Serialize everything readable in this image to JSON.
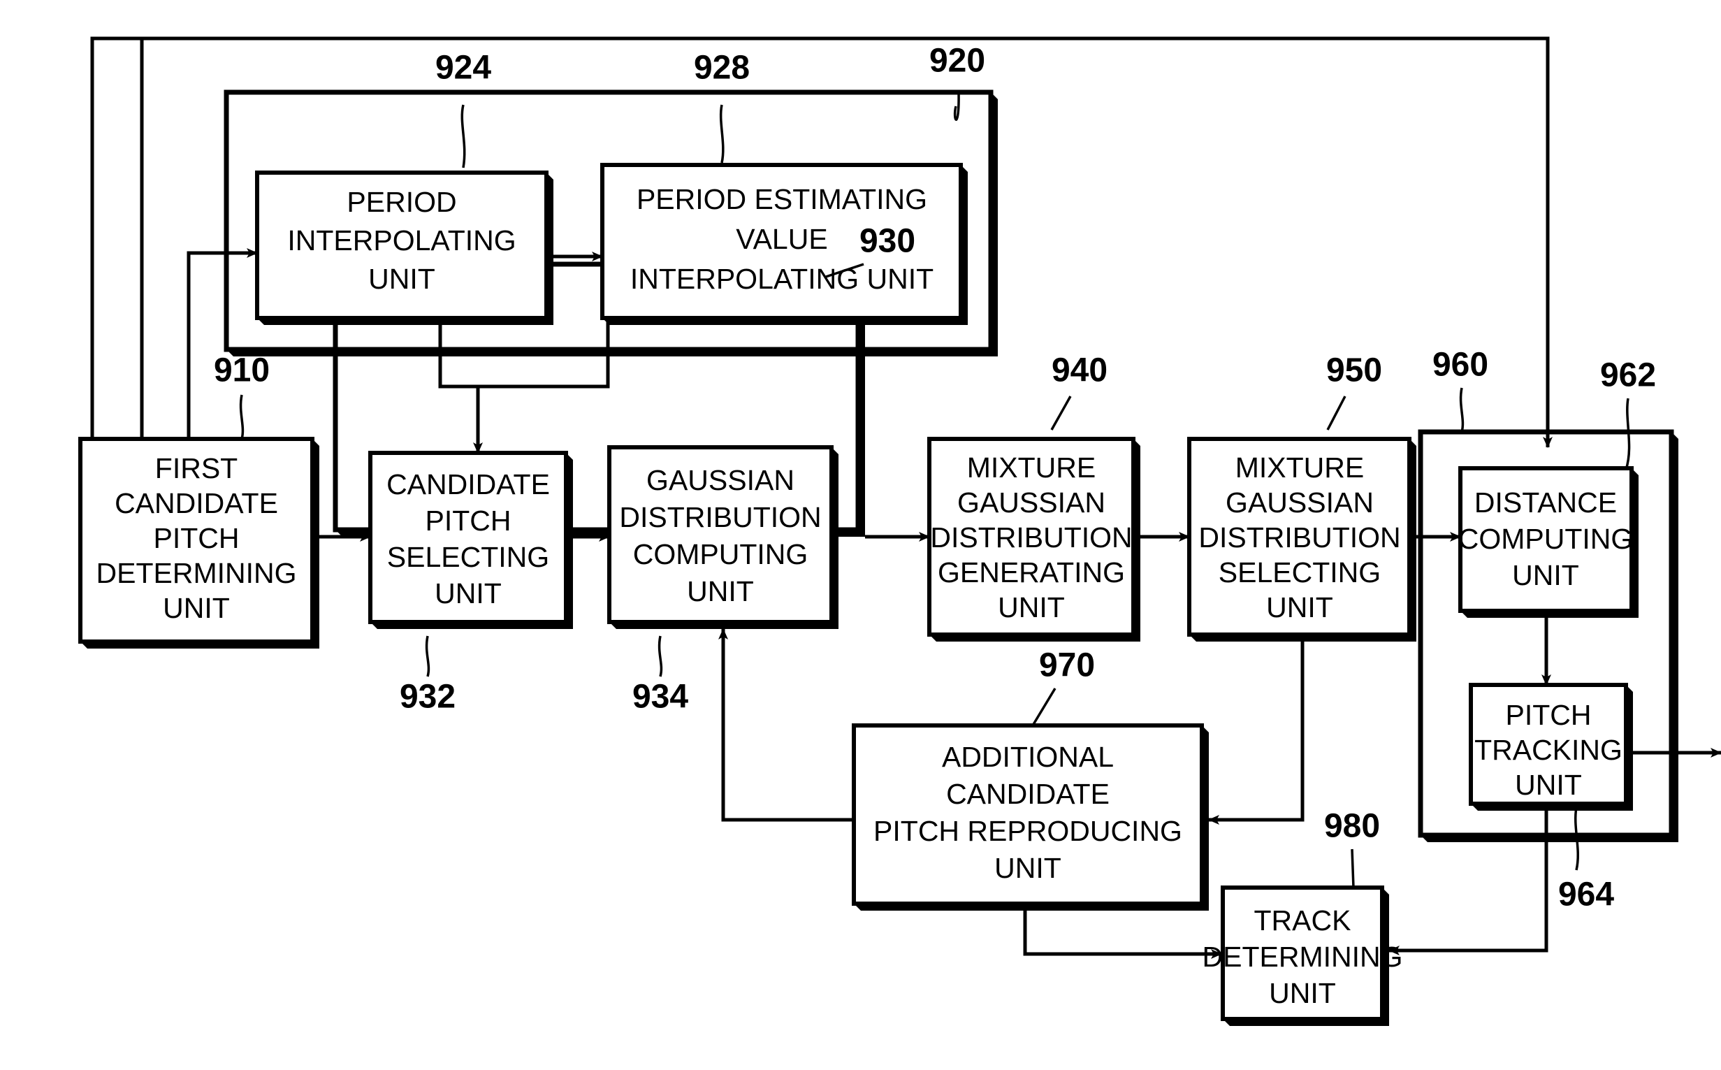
{
  "figure": {
    "type": "patent-block-diagram",
    "blocks": [
      {
        "id": "block-910",
        "ref": "910",
        "lines": [
          "FIRST",
          "CANDIDATE",
          "PITCH",
          "DETERMINING",
          "UNIT"
        ]
      },
      {
        "id": "block-924",
        "ref": "924",
        "lines": [
          "PERIOD",
          "INTERPOLATING",
          "UNIT"
        ]
      },
      {
        "id": "block-928",
        "ref": "928",
        "lines": [
          "PERIOD ESTIMATING",
          "VALUE",
          "INTERPOLATING UNIT"
        ]
      },
      {
        "id": "block-932",
        "ref": "932",
        "lines": [
          "CANDIDATE",
          "PITCH",
          "SELECTING",
          "UNIT"
        ]
      },
      {
        "id": "block-934",
        "ref": "934",
        "lines": [
          "GAUSSIAN",
          "DISTRIBUTION",
          "COMPUTING",
          "UNIT"
        ]
      },
      {
        "id": "block-940",
        "ref": "940",
        "lines": [
          "MIXTURE",
          "GAUSSIAN",
          "DISTRIBUTION",
          "GENERATING",
          "UNIT"
        ]
      },
      {
        "id": "block-950",
        "ref": "950",
        "lines": [
          "MIXTURE",
          "GAUSSIAN",
          "DISTRIBUTION",
          "SELECTING",
          "UNIT"
        ]
      },
      {
        "id": "block-962",
        "ref": "962",
        "lines": [
          "DISTANCE",
          "COMPUTING",
          "UNIT"
        ]
      },
      {
        "id": "block-964",
        "ref": "964",
        "lines": [
          "PITCH",
          "TRACKING",
          "UNIT"
        ]
      },
      {
        "id": "block-970",
        "ref": "970",
        "lines": [
          "ADDITIONAL",
          "CANDIDATE",
          "PITCH REPRODUCING",
          "UNIT"
        ]
      },
      {
        "id": "block-980",
        "ref": "980",
        "lines": [
          "TRACK",
          "DETERMINING",
          "UNIT"
        ]
      }
    ],
    "groups": [
      {
        "id": "group-920",
        "ref": "920",
        "contains": [
          "block-924",
          "block-928"
        ]
      },
      {
        "id": "group-930",
        "ref": "930",
        "contains": [
          "block-932",
          "block-934"
        ]
      },
      {
        "id": "group-960",
        "ref": "960",
        "contains": [
          "block-962",
          "block-964"
        ]
      }
    ],
    "reference_numerals": {
      "n910": "910",
      "n920": "920",
      "n924": "924",
      "n928": "928",
      "n930": "930",
      "n932": "932",
      "n934": "934",
      "n940": "940",
      "n950": "950",
      "n960": "960",
      "n962": "962",
      "n964": "964",
      "n970": "970",
      "n980": "980"
    },
    "block_text": {
      "b910_l1": "FIRST",
      "b910_l2": "CANDIDATE",
      "b910_l3": "PITCH",
      "b910_l4": "DETERMINING",
      "b910_l5": "UNIT",
      "b924_l1": "PERIOD",
      "b924_l2": "INTERPOLATING",
      "b924_l3": "UNIT",
      "b928_l1": "PERIOD ESTIMATING",
      "b928_l2": "VALUE",
      "b928_l3": "INTERPOLATING UNIT",
      "b932_l1": "CANDIDATE",
      "b932_l2": "PITCH",
      "b932_l3": "SELECTING",
      "b932_l4": "UNIT",
      "b934_l1": "GAUSSIAN",
      "b934_l2": "DISTRIBUTION",
      "b934_l3": "COMPUTING",
      "b934_l4": "UNIT",
      "b940_l1": "MIXTURE",
      "b940_l2": "GAUSSIAN",
      "b940_l3": "DISTRIBUTION",
      "b940_l4": "GENERATING",
      "b940_l5": "UNIT",
      "b950_l1": "MIXTURE",
      "b950_l2": "GAUSSIAN",
      "b950_l3": "DISTRIBUTION",
      "b950_l4": "SELECTING",
      "b950_l5": "UNIT",
      "b962_l1": "DISTANCE",
      "b962_l2": "COMPUTING",
      "b962_l3": "UNIT",
      "b964_l1": "PITCH",
      "b964_l2": "TRACKING",
      "b964_l3": "UNIT",
      "b970_l1": "ADDITIONAL",
      "b970_l2": "CANDIDATE",
      "b970_l3": "PITCH REPRODUCING",
      "b970_l4": "UNIT",
      "b980_l1": "TRACK",
      "b980_l2": "DETERMINING",
      "b980_l3": "UNIT"
    },
    "colors": {
      "ink": "#000000",
      "paper": "#ffffff"
    }
  }
}
